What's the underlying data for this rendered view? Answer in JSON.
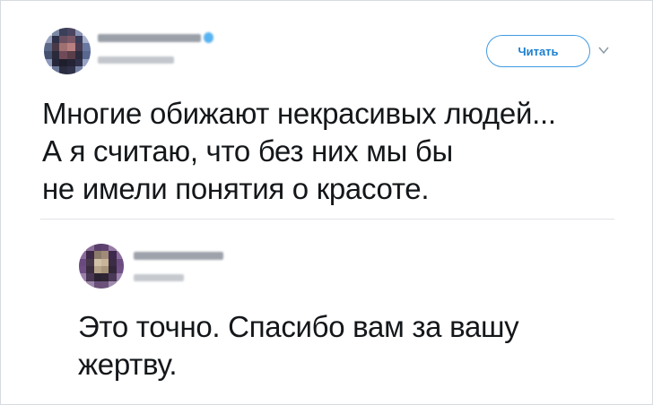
{
  "tweet": {
    "follow_label": "Читать",
    "text_lines": [
      "Многие обижают некрасивых людей...",
      "А я считаю, что без них мы бы",
      "не имели понятия о красоте."
    ]
  },
  "reply": {
    "text_lines": [
      "Это точно. Спасибо вам за вашу",
      "жертву."
    ]
  },
  "colors": {
    "accent": "#1b7fd0",
    "verified_badge": "#1da1f2",
    "text": "#14171a"
  }
}
